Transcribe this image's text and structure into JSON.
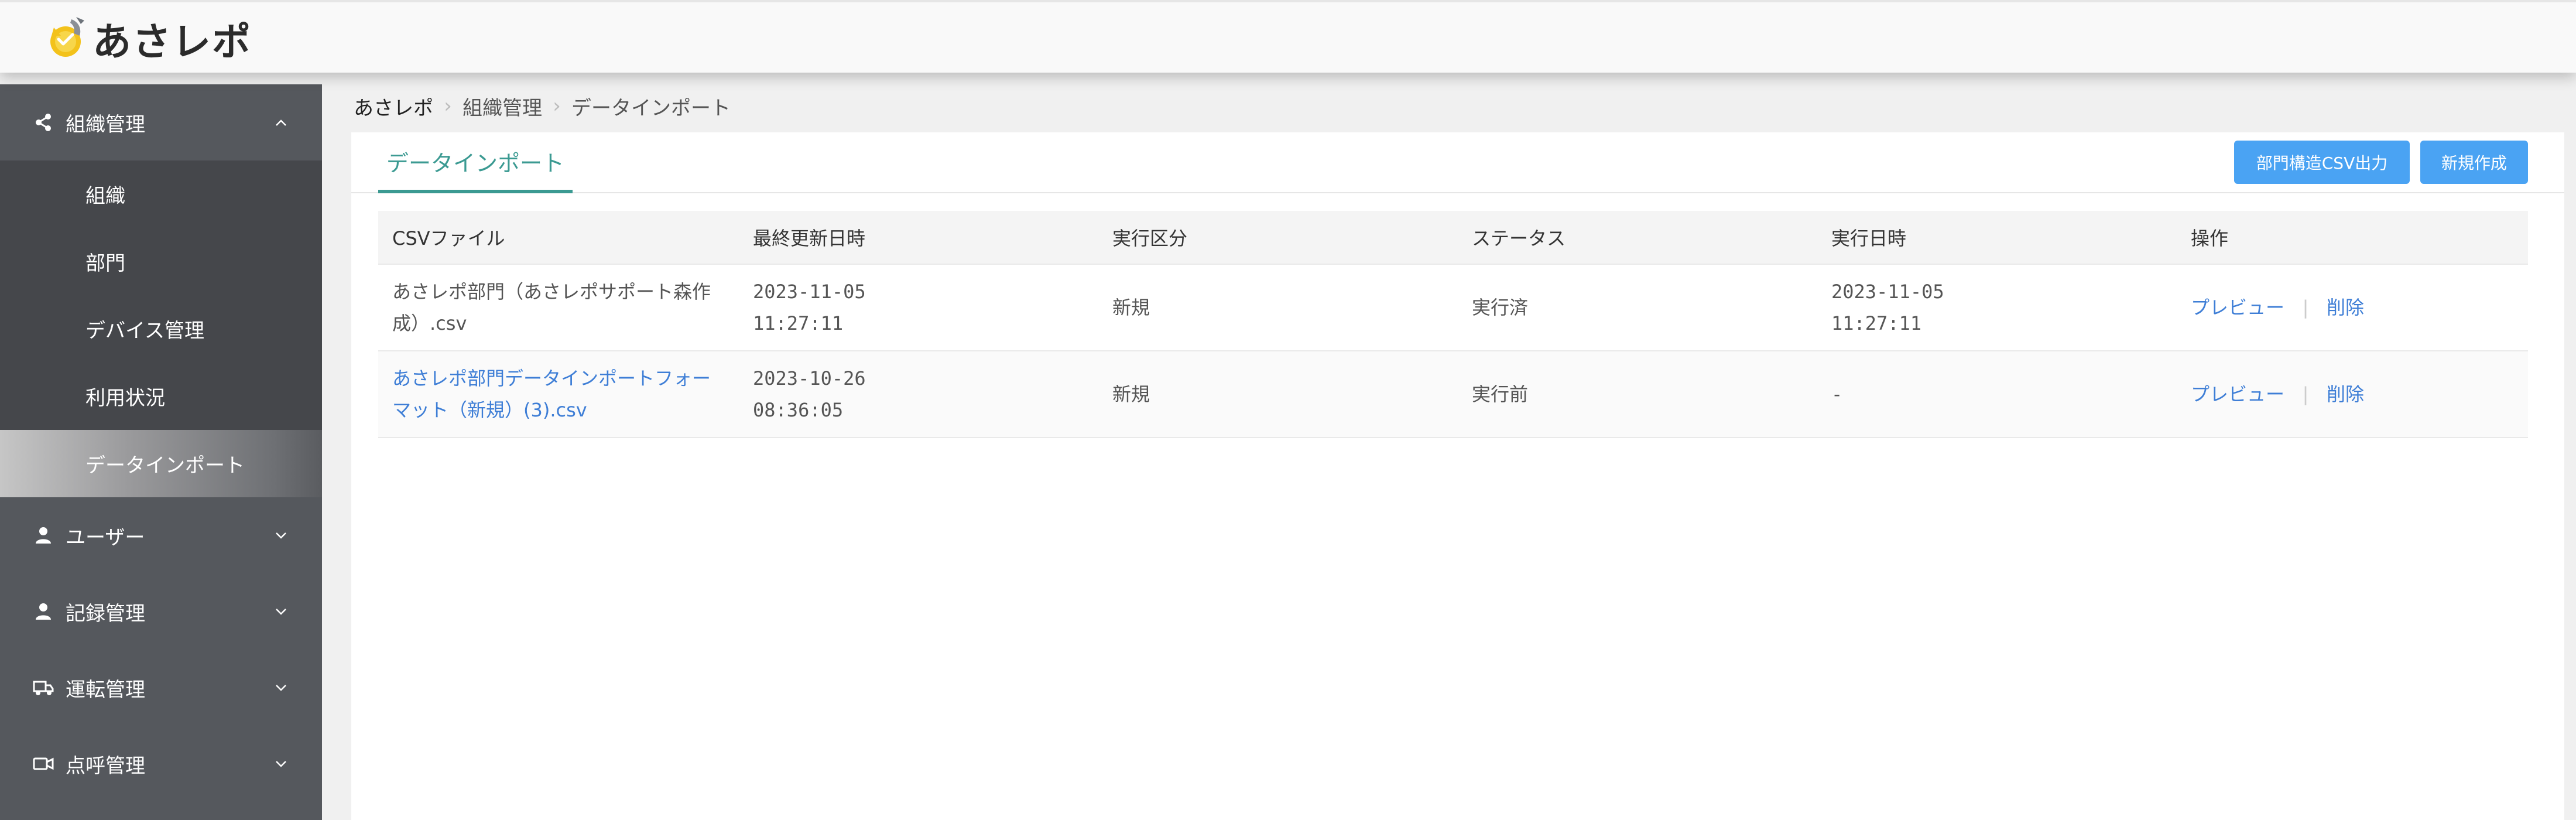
{
  "app": {
    "name": "あさレポ"
  },
  "sidebar": {
    "sections": [
      {
        "label": "組織管理",
        "icon": "share-icon",
        "expanded": true
      },
      {
        "label": "ユーザー",
        "icon": "user-icon",
        "expanded": false
      },
      {
        "label": "記録管理",
        "icon": "user-icon",
        "expanded": false
      },
      {
        "label": "運転管理",
        "icon": "truck-icon",
        "expanded": false
      },
      {
        "label": "点呼管理",
        "icon": "video-icon",
        "expanded": false
      }
    ],
    "sub_items": [
      {
        "label": "組織",
        "active": false
      },
      {
        "label": "部門",
        "active": false
      },
      {
        "label": "デバイス管理",
        "active": false
      },
      {
        "label": "利用状況",
        "active": false
      },
      {
        "label": "データインポート",
        "active": true
      }
    ]
  },
  "breadcrumb": [
    "あさレポ",
    "組織管理",
    "データインポート"
  ],
  "tab": {
    "label": "データインポート"
  },
  "buttons": {
    "export_label": "部門構造CSV出力",
    "new_label": "新規作成"
  },
  "table": {
    "headers": [
      "CSVファイル",
      "最終更新日時",
      "実行区分",
      "ステータス",
      "実行日時",
      "操作"
    ],
    "rows": [
      {
        "file_line1": "あさレポ部門（あさレポサポート森作",
        "file_line2": "成）.csv",
        "updated_date": "2023-11-05",
        "updated_time": "11:27:11",
        "type": "新規",
        "status": "実行済",
        "exec_date": "2023-11-05",
        "exec_time": "11:27:11",
        "preview": "プレビュー",
        "delete": "削除"
      },
      {
        "file_line1": "あさレポ部門データインポートフォー",
        "file_line2": "マット（新規）(3).csv",
        "updated_date": "2023-10-26",
        "updated_time": "08:36:05",
        "type": "新規",
        "status": "実行前",
        "exec_date": "-",
        "exec_time": "",
        "preview": "プレビュー",
        "delete": "削除"
      }
    ]
  },
  "colors": {
    "sidebar_bg": "#55585d",
    "accent_teal": "#3b9a92",
    "button_blue": "#4aa3f3",
    "link_blue": "#3e7ed6"
  }
}
